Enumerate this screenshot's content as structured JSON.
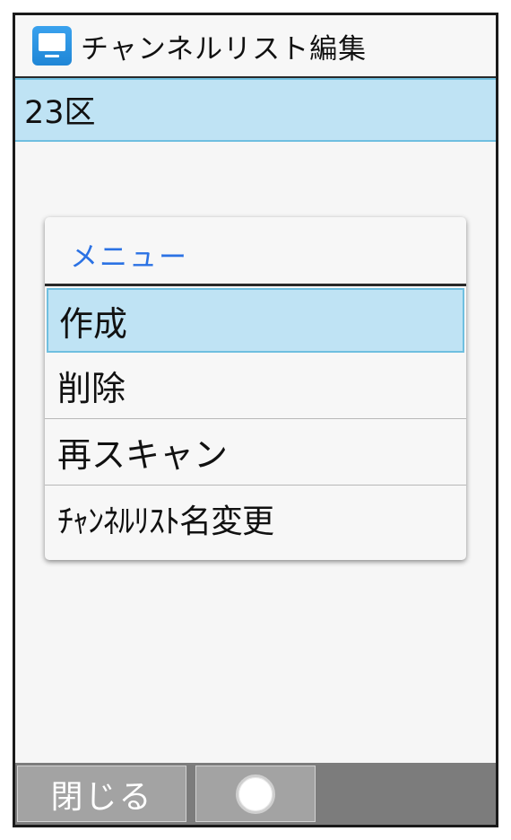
{
  "header": {
    "icon": "tv-icon",
    "title": "チャンネルリスト編集"
  },
  "channel_list": {
    "selected_name": "23区"
  },
  "menu": {
    "title": "メニュー",
    "items": [
      {
        "label": "作成",
        "selected": true
      },
      {
        "label": "削除",
        "selected": false
      },
      {
        "label": "再スキャン",
        "selected": false
      },
      {
        "label": "ﾁｬﾝﾈﾙﾘｽﾄ名変更",
        "selected": false
      }
    ]
  },
  "softkeys": {
    "left_label": "閉じる",
    "center_icon": "circle-select-icon"
  },
  "colors": {
    "selection_fill": "#bfe3f4",
    "selection_border": "#6fbfe0",
    "menu_title": "#2b72e4",
    "softkey_bar": "#7c7c7c",
    "softkey_button": "#a3a3a3"
  }
}
